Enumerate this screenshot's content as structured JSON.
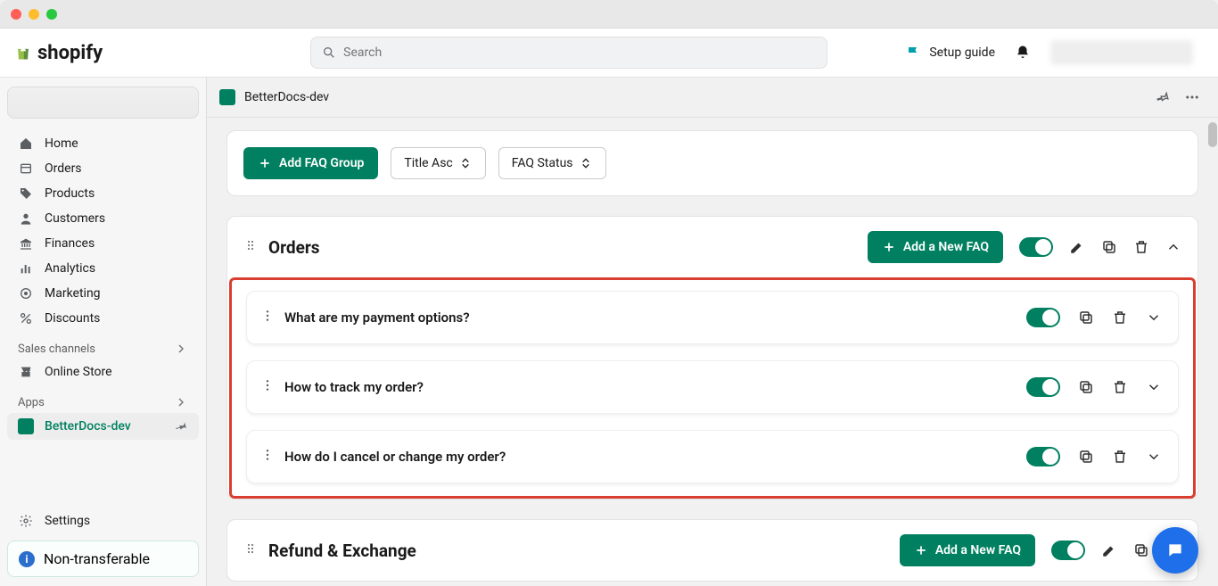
{
  "brand": "shopify",
  "search": {
    "placeholder": "Search"
  },
  "top": {
    "setup_guide": "Setup guide"
  },
  "sidebar": {
    "items": [
      {
        "label": "Home"
      },
      {
        "label": "Orders"
      },
      {
        "label": "Products"
      },
      {
        "label": "Customers"
      },
      {
        "label": "Finances"
      },
      {
        "label": "Analytics"
      },
      {
        "label": "Marketing"
      },
      {
        "label": "Discounts"
      }
    ],
    "sales_channels_head": "Sales channels",
    "online_store": "Online Store",
    "apps_head": "Apps",
    "app_active": "BetterDocs-dev",
    "settings": "Settings",
    "non_transferable": "Non-transferable"
  },
  "app_header": {
    "title": "BetterDocs-dev"
  },
  "toolbar": {
    "add_group": "Add FAQ Group",
    "sort": "Title Asc",
    "status": "FAQ Status"
  },
  "groups": [
    {
      "title": "Orders",
      "add_faq": "Add a New FAQ",
      "faqs": [
        {
          "question": "What are my payment options?"
        },
        {
          "question": "How to track my order?"
        },
        {
          "question": "How do I cancel or change my order?"
        }
      ]
    },
    {
      "title": "Refund & Exchange",
      "add_faq": "Add a New FAQ"
    }
  ]
}
